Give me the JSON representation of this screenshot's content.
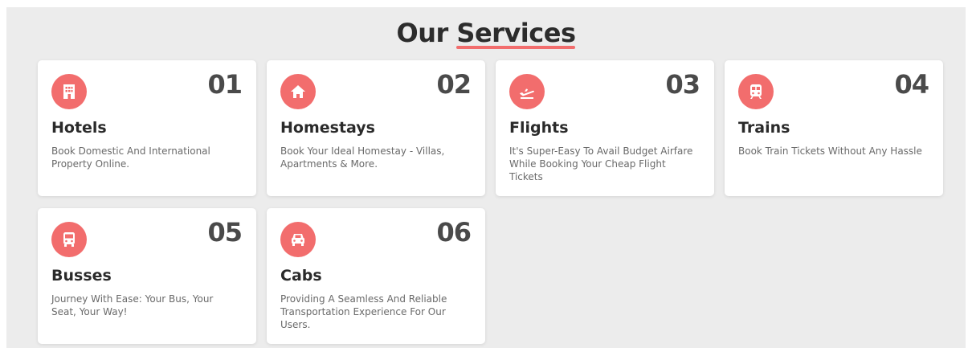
{
  "heading": {
    "part1": "Our ",
    "part2": "Services"
  },
  "colors": {
    "accent": "#f26d6d",
    "background": "#ececec",
    "card": "#ffffff"
  },
  "services": [
    {
      "number": "01",
      "title": "Hotels",
      "description": "Book Domestic And International Property Online.",
      "icon": "hotel-icon"
    },
    {
      "number": "02",
      "title": "Homestays",
      "description": "Book Your Ideal Homestay - Villas, Apartments & More.",
      "icon": "home-icon"
    },
    {
      "number": "03",
      "title": "Flights",
      "description": "It's Super-Easy To Avail Budget Airfare While Booking Your Cheap Flight Tickets",
      "icon": "plane-icon"
    },
    {
      "number": "04",
      "title": "Trains",
      "description": "Book Train Tickets Without Any Hassle",
      "icon": "train-icon"
    },
    {
      "number": "05",
      "title": "Busses",
      "description": "Journey With Ease: Your Bus, Your Seat, Your Way!",
      "icon": "bus-icon"
    },
    {
      "number": "06",
      "title": "Cabs",
      "description": "Providing A Seamless And Reliable Transportation Experience For Our Users.",
      "icon": "car-icon"
    }
  ]
}
